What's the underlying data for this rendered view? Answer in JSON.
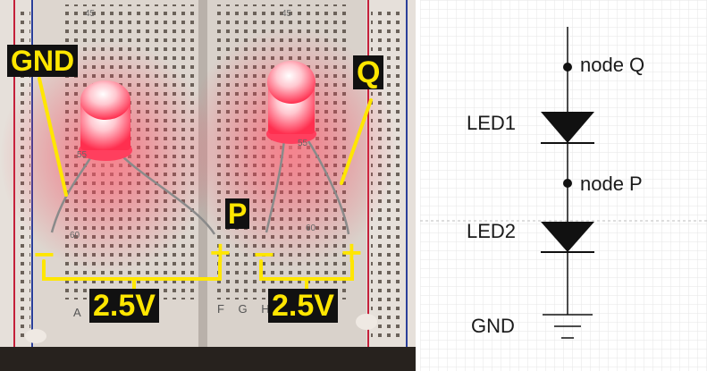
{
  "photo": {
    "labels": {
      "gnd": "GND",
      "q": "Q",
      "p": "P",
      "v1": "2.5V",
      "v2": "2.5V"
    },
    "signs": {
      "minus": "−",
      "plus": "+"
    },
    "breadboard_numbers": {
      "n45": "45",
      "n55": "55",
      "n60": "60"
    },
    "breadboard_letters": {
      "left": "A",
      "right": "F G H"
    },
    "colors": {
      "annotation": "#ffe600",
      "led_glow": "#ff3b55",
      "tag_bg": "#111111"
    }
  },
  "schematic": {
    "labels": {
      "node_q": "node Q",
      "led1": "LED1",
      "node_p": "node P",
      "led2": "LED2",
      "gnd": "GND"
    },
    "colors": {
      "wire": "#111111",
      "grid": "#e6e6e6"
    }
  }
}
